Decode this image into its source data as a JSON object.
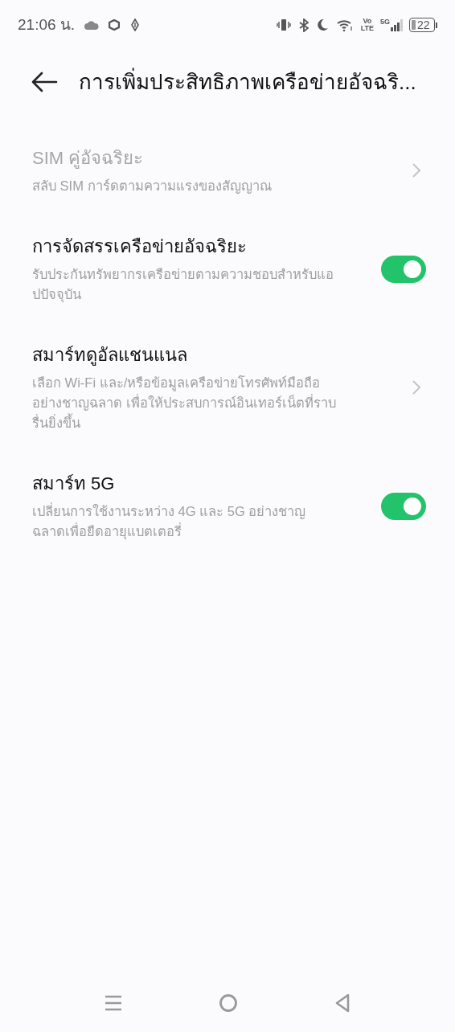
{
  "status_bar": {
    "time": "21:06 น.",
    "volte_top": "Vo",
    "volte_bottom": "LTE",
    "network": "5G",
    "battery": "22"
  },
  "header": {
    "title": "การเพิ่มประสิทธิภาพเครือข่ายอัจฉริ..."
  },
  "items": [
    {
      "kind": "link",
      "title": "SIM คู่อัจฉริยะ",
      "subtitle": "สลับ SIM การ์ดตามความแรงของสัญญาณ",
      "disabled": true
    },
    {
      "kind": "switch",
      "title": "การจัดสรรเครือข่ายอัจฉริยะ",
      "subtitle": "รับประกันทรัพยากรเครือข่ายตามความชอบสำหรับแอ\nปปัจจุบัน",
      "disabled": false,
      "on": true
    },
    {
      "kind": "link",
      "title": "สมาร์ทดูอัลแชนแนล",
      "subtitle": "เลือก Wi-Fi และ/หรือข้อมูลเครือข่ายโทรศัพท์มือถือ\nอย่างชาญฉลาด เพื่อให้ประสบการณ์อินเทอร์เน็ตที่ราบ\nรื่นยิ่งขึ้น",
      "disabled": false
    },
    {
      "kind": "switch",
      "title": "สมาร์ท 5G",
      "subtitle": "เปลี่ยนการใช้งานระหว่าง 4G และ 5G อย่างชาญ\nฉลาดเพื่อยืดอายุแบตเตอรี่",
      "disabled": false,
      "on": true
    }
  ]
}
